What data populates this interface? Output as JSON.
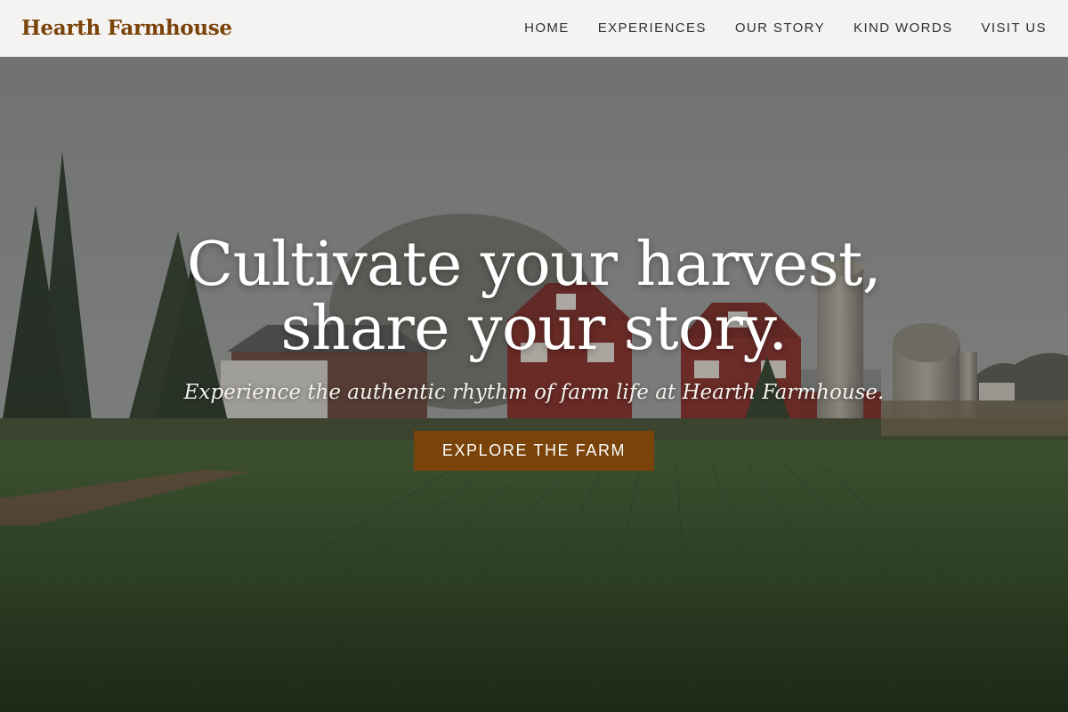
{
  "brand": {
    "name": "Hearth Farmhouse",
    "color": "#7a4309"
  },
  "nav": {
    "items": [
      {
        "label": "HOME"
      },
      {
        "label": "EXPERIENCES"
      },
      {
        "label": "OUR STORY"
      },
      {
        "label": "KIND WORDS"
      },
      {
        "label": "VISIT US"
      }
    ]
  },
  "hero": {
    "headline_line1": "Cultivate your harvest,",
    "headline_line2": "share your story.",
    "subheadline": "Experience the authentic rhythm of farm life at Hearth Farmhouse.",
    "cta_label": "EXPLORE THE FARM",
    "cta_color": "#7a4309",
    "background_image": "farm-landscape-red-barns-silos-green-field"
  }
}
